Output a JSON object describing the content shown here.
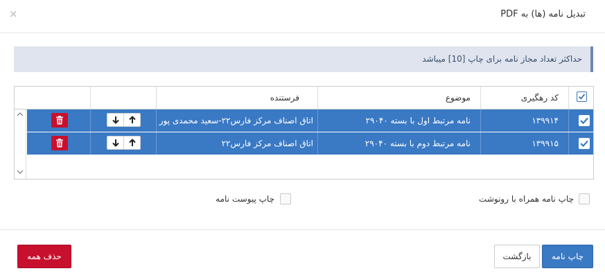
{
  "dialog": {
    "title": "تبدیل نامه (ها) به PDF",
    "close_icon": "×",
    "notice": "حداکثر تعداد مجاز نامه برای چاپ [10] میباشد"
  },
  "table": {
    "columns": {
      "tracking_code": "کد رهگیری",
      "subject": "موضوع",
      "sender": "فرستنده"
    },
    "rows": [
      {
        "checked": true,
        "tracking_code": "۱۳۹۹۱۴",
        "subject": "نامه مرتبط اول با بسته ۲۹۰۴۰",
        "sender": "اتاق اصناف مرکز فارس۲۲-سعید محمدی پور"
      },
      {
        "checked": true,
        "tracking_code": "۱۳۹۹۱۵",
        "subject": "نامه مرتبط دوم با بسته ۲۹۰۴۰",
        "sender": "اتاق اصناف مرکز فارس۲۲"
      }
    ]
  },
  "options": {
    "print_with_copy": "چاپ نامه همراه با رونوشت",
    "print_attachments": "چاپ پیوست نامه"
  },
  "buttons": {
    "print": "چاپ نامه",
    "back": "بازگشت",
    "delete_all": "حذف همه"
  },
  "colors": {
    "accent": "#3a79c4",
    "danger": "#c7102e",
    "notice_bg": "#dfe4ee"
  }
}
